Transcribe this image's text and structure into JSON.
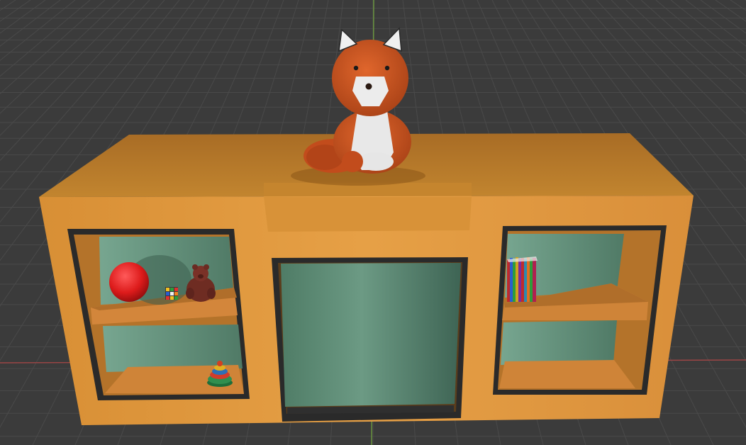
{
  "scene": {
    "background_color": "#3b3b3b",
    "grid_color": "#4a4a4a",
    "axis_x_color": "#b24a4a",
    "axis_y_color": "#7fb04a",
    "objects": [
      {
        "name": "cabinet",
        "color": "#e39c41"
      },
      {
        "name": "fox-plush",
        "color": "#c9521f",
        "accent": "#e6e6e6"
      },
      {
        "name": "red-ball",
        "color": "#e01818"
      },
      {
        "name": "rubiks-cube",
        "color": "#f0c020"
      },
      {
        "name": "teddy-bear",
        "color": "#6b2a22"
      },
      {
        "name": "stacking-toy",
        "color": "#2f8f4f"
      },
      {
        "name": "books",
        "color": "#c02b2b"
      },
      {
        "name": "glass-door",
        "color": "#5d8d77"
      }
    ]
  }
}
